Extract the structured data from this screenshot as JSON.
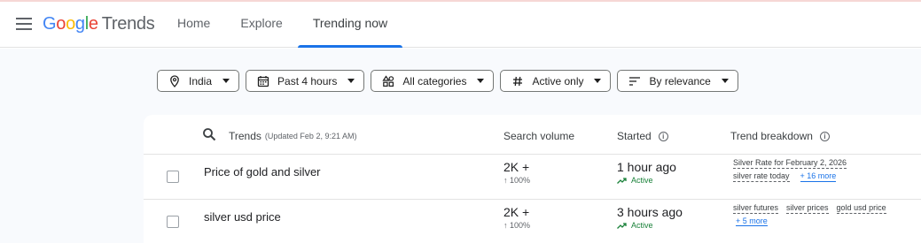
{
  "colors": {
    "accent": "#1a73e8",
    "active_green": "#188038"
  },
  "header": {
    "logo": {
      "g1": "G",
      "o1": "o",
      "o2": "o",
      "g2": "g",
      "l": "l",
      "e": "e",
      "product": "Trends"
    },
    "tabs": [
      {
        "label": "Home"
      },
      {
        "label": "Explore"
      },
      {
        "label": "Trending now"
      }
    ]
  },
  "filters": [
    {
      "label": "India",
      "icon": "location-pin-icon"
    },
    {
      "label": "Past 4 hours",
      "icon": "calendar-icon"
    },
    {
      "label": "All categories",
      "icon": "categories-icon"
    },
    {
      "label": "Active only",
      "icon": "hashtag-icon"
    },
    {
      "label": "By relevance",
      "icon": "sort-icon"
    }
  ],
  "table": {
    "headers": {
      "trends": "Trends",
      "updated": "(Updated Feb 2, 9:21 AM)",
      "volume": "Search volume",
      "started": "Started",
      "breakdown": "Trend breakdown"
    },
    "rows": [
      {
        "title": "Price of gold and silver",
        "volume": "2K +",
        "volume_change": "↑ 100%",
        "started": "1 hour ago",
        "status": "Active",
        "breakdown_line1": [
          "Silver Rate for February 2, 2026"
        ],
        "breakdown_line2": [
          "silver rate today"
        ],
        "more": "+ 16 more"
      },
      {
        "title": "silver usd price",
        "volume": "2K +",
        "volume_change": "↑ 100%",
        "started": "3 hours ago",
        "status": "Active",
        "breakdown_line1": [
          "silver futures",
          "silver prices",
          "gold usd price"
        ],
        "breakdown_line2": [],
        "more": "+ 5 more"
      }
    ]
  }
}
